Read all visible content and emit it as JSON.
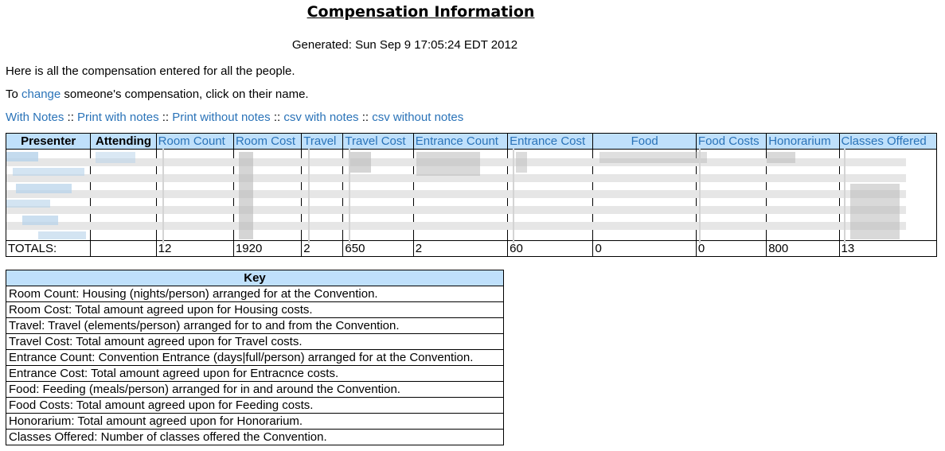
{
  "title": "Compensation Information",
  "generated": "Generated: Sun Sep 9 17:05:24 EDT 2012",
  "intro": "Here is all the compensation entered for all the people.",
  "change_line": {
    "prefix": "To ",
    "link": "change",
    "suffix": " someone's compensation, click on their name."
  },
  "links": [
    {
      "label": "With Notes"
    },
    {
      "label": "Print with notes"
    },
    {
      "label": "Print without notes"
    },
    {
      "label": "csv with notes"
    },
    {
      "label": "csv without notes"
    }
  ],
  "link_separator": " :: ",
  "table": {
    "headers": [
      "Presenter",
      "Attending",
      "Room Count",
      "Room Cost",
      "Travel",
      "Travel Cost",
      "Entrance Count",
      "Entrance Cost",
      "Food",
      "Food Costs",
      "Honorarium",
      "Classes Offered"
    ],
    "totals": [
      "TOTALS:",
      "",
      "12",
      "1920",
      "2",
      "650",
      "2",
      "60",
      "0",
      "0",
      "800",
      "13"
    ]
  },
  "key": {
    "header": "Key",
    "rows": [
      "Room Count: Housing (nights/person) arranged for at the Convention.",
      "Room Cost: Total amount agreed upon for Housing costs.",
      "Travel: Travel (elements/person) arranged for to and from the Convention.",
      "Travel Cost: Total amount agreed upon for Travel costs.",
      "Entrance Count: Convention Entrance (days|full/person) arranged for at the Convention.",
      "Entrance Cost: Total amount agreed upon for Entracnce costs.",
      "Food: Feeding (meals/person) arranged for in and around the Convention.",
      "Food Costs: Total amount agreed upon for Feeding costs.",
      "Honorarium: Total amount agreed upon for Honorarium.",
      "Classes Offered: Number of classes offered the Convention."
    ]
  }
}
